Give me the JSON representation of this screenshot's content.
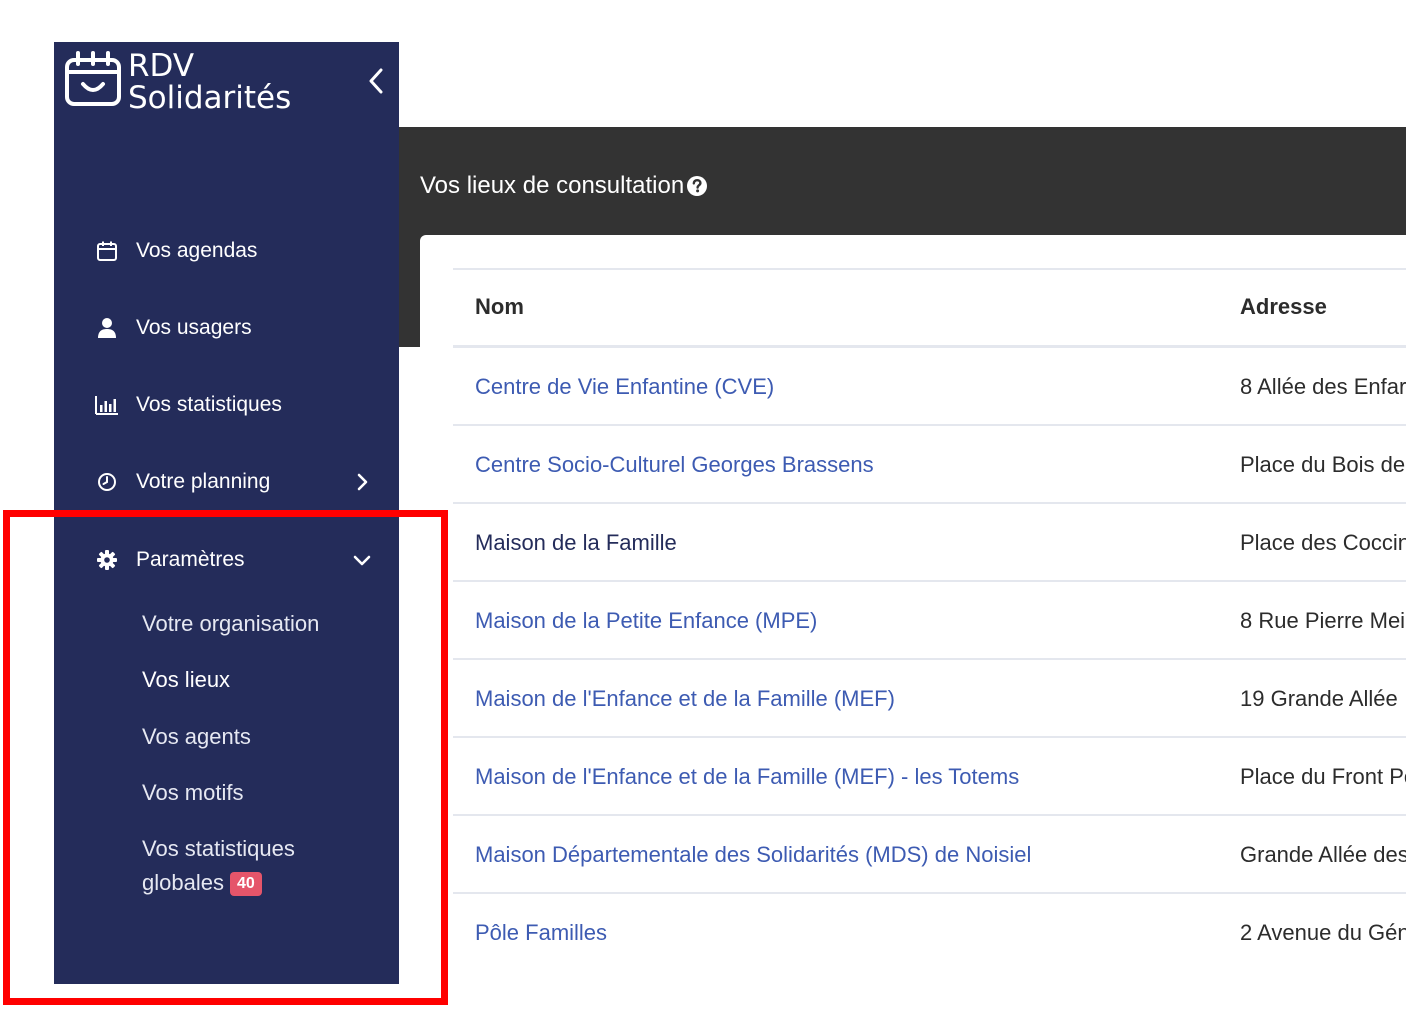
{
  "brand": {
    "line1": "RDV",
    "line2": "Solidarités"
  },
  "sidebar": {
    "items": [
      {
        "label": "Vos agendas",
        "icon": "calendar-icon"
      },
      {
        "label": "Vos usagers",
        "icon": "user-icon"
      },
      {
        "label": "Vos statistiques",
        "icon": "bar-chart-icon"
      },
      {
        "label": "Votre planning",
        "icon": "clock-icon"
      },
      {
        "label": "Paramètres",
        "icon": "gear-icon"
      }
    ],
    "subitems": [
      {
        "label": "Votre organisation"
      },
      {
        "label": "Vos lieux"
      },
      {
        "label": "Vos agents"
      },
      {
        "label": "Vos motifs"
      },
      {
        "label_line1": "Vos statistiques",
        "label_line2": "globales",
        "badge": "40"
      }
    ]
  },
  "header": {
    "title": "Vos lieux de consultation"
  },
  "table": {
    "columns": [
      "Nom",
      "Adresse"
    ],
    "rows": [
      {
        "name": "Centre de Vie Enfantine (CVE)",
        "address": "8 Allée des Enfar"
      },
      {
        "name": "Centre Socio-Culturel Georges Brassens",
        "address": "Place du Bois de"
      },
      {
        "name": "Maison de la Famille",
        "address": "Place des Coccin"
      },
      {
        "name": "Maison de la Petite Enfance (MPE)",
        "address": "8 Rue Pierre Mei"
      },
      {
        "name": "Maison de l'Enfance et de la Famille (MEF)",
        "address": "19 Grande Allée"
      },
      {
        "name": "Maison de l'Enfance et de la Famille (MEF) - les Totems",
        "address": "Place du Front Po"
      },
      {
        "name": "Maison Départementale des Solidarités (MDS) de Noisiel",
        "address": "Grande Allée des"
      },
      {
        "name": "Pôle Familles",
        "address": "2 Avenue du Gén"
      }
    ]
  },
  "colors": {
    "sidebar": "#242c5a",
    "topbar": "#333333",
    "link": "#3d5bb2",
    "badge": "#e5556a",
    "highlight": "#ff0000"
  }
}
